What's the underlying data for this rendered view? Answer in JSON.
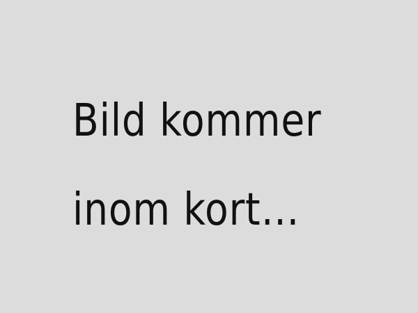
{
  "placeholder": {
    "background_color": "#dcdcdc",
    "text_color": "#111111",
    "message": "Bild kommer\ninom kort…"
  }
}
